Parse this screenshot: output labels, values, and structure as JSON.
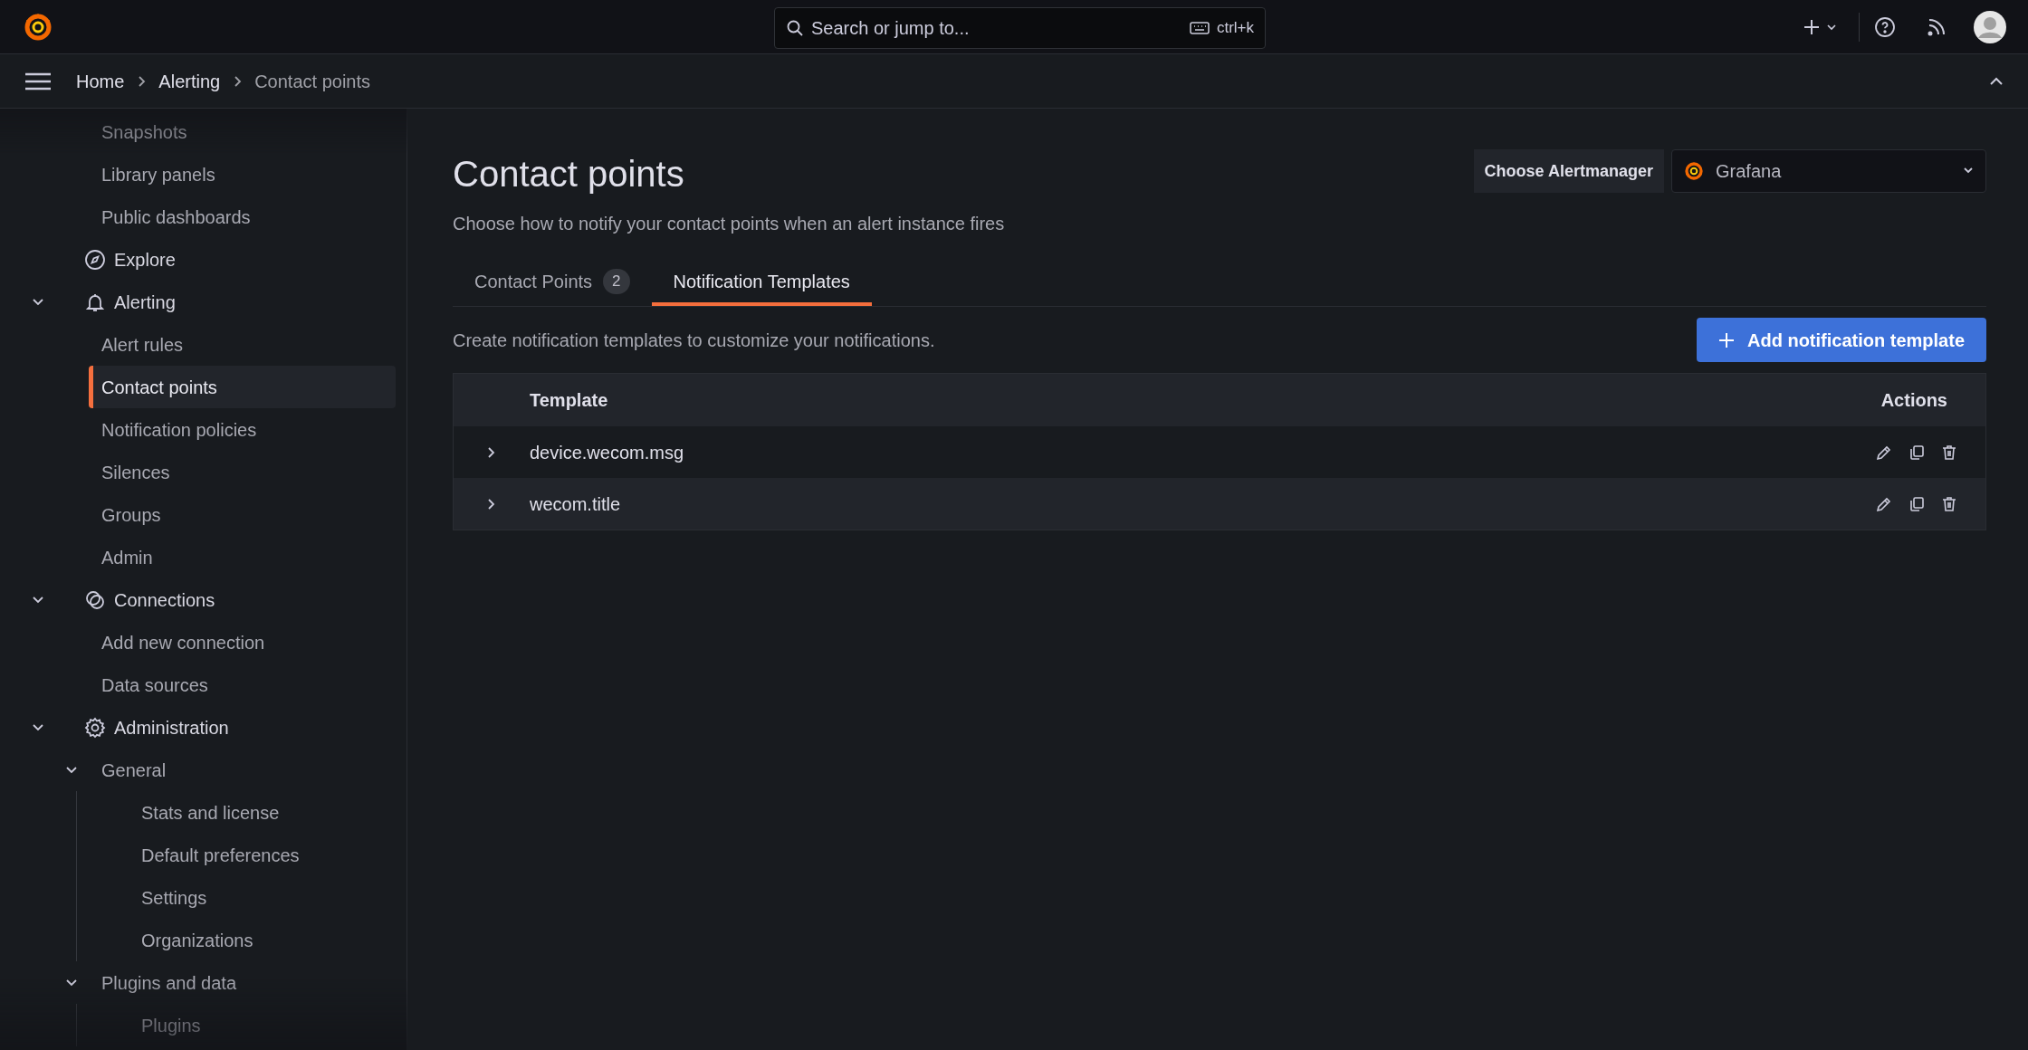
{
  "top_bar": {
    "search": {
      "placeholder": "Search or jump to...",
      "shortcut": "ctrl+k"
    }
  },
  "breadcrumbs": [
    {
      "label": "Home",
      "current": false
    },
    {
      "label": "Alerting",
      "current": false
    },
    {
      "label": "Contact points",
      "current": true
    }
  ],
  "sidebar": {
    "items_above": [
      {
        "label": "Snapshots",
        "selected": false
      },
      {
        "label": "Library panels",
        "selected": false
      },
      {
        "label": "Public dashboards",
        "selected": false
      }
    ],
    "items": [
      {
        "label": "Explore",
        "selected": false
      },
      {
        "label": "Alerting",
        "selected": false,
        "expanded": true,
        "children": [
          {
            "label": "Alert rules",
            "selected": false
          },
          {
            "label": "Contact points",
            "selected": true
          },
          {
            "label": "Notification policies",
            "selected": false
          },
          {
            "label": "Silences",
            "selected": false
          },
          {
            "label": "Groups",
            "selected": false
          },
          {
            "label": "Admin",
            "selected": false
          }
        ]
      },
      {
        "label": "Connections",
        "selected": false,
        "expanded": true,
        "children": [
          {
            "label": "Add new connection",
            "selected": false
          },
          {
            "label": "Data sources",
            "selected": false
          }
        ]
      },
      {
        "label": "Administration",
        "selected": false,
        "expanded": true,
        "children": [
          {
            "label": "General",
            "selected": false,
            "expanded": true,
            "children": [
              {
                "label": "Stats and license",
                "selected": false
              },
              {
                "label": "Default preferences",
                "selected": false
              },
              {
                "label": "Settings",
                "selected": false
              },
              {
                "label": "Organizations",
                "selected": false
              }
            ]
          },
          {
            "label": "Plugins and data",
            "selected": false,
            "expanded": true,
            "children": [
              {
                "label": "Plugins",
                "selected": false
              }
            ]
          }
        ]
      }
    ]
  },
  "page": {
    "title": "Contact points",
    "subtitle": "Choose how to notify your contact points when an alert instance fires",
    "alertmanager": {
      "label": "Choose Alertmanager",
      "value": "Grafana"
    },
    "tabs": [
      {
        "label": "Contact Points",
        "count": "2",
        "selected": false
      },
      {
        "label": "Notification Templates",
        "selected": true
      }
    ],
    "description": "Create notification templates to customize your notifications.",
    "add_button": "Add notification template",
    "table": {
      "columns": [
        "Template",
        "Actions"
      ],
      "rows": [
        {
          "template": "device.wecom.msg",
          "expanded": false
        },
        {
          "template": "wecom.title",
          "expanded": false
        }
      ]
    }
  }
}
